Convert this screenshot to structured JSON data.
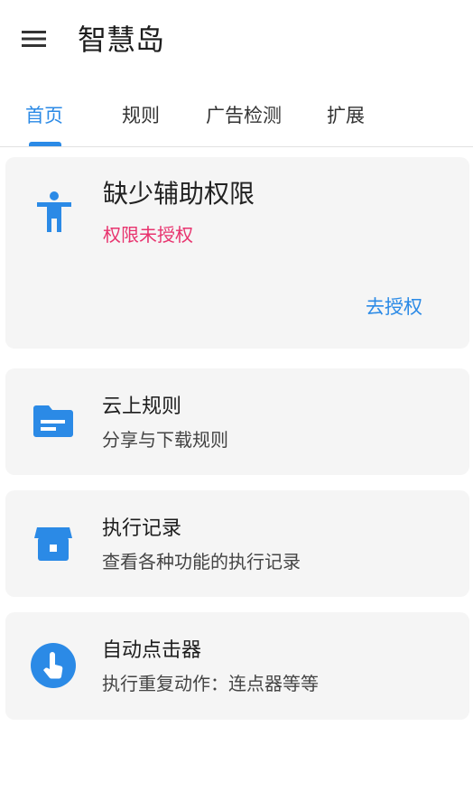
{
  "app": {
    "title": "智慧岛"
  },
  "tabs": [
    {
      "label": "首页",
      "active": true
    },
    {
      "label": "规则",
      "active": false
    },
    {
      "label": "广告检测",
      "active": false
    },
    {
      "label": "扩展",
      "active": false
    }
  ],
  "permission_card": {
    "icon": "accessibility-icon",
    "title": "缺少辅助权限",
    "subtitle": "权限未授权",
    "action_label": "去授权"
  },
  "cards": [
    {
      "icon": "folder-icon",
      "title": "云上规则",
      "subtitle": "分享与下载规则"
    },
    {
      "icon": "archive-icon",
      "title": "执行记录",
      "subtitle": "查看各种功能的执行记录"
    },
    {
      "icon": "touch-icon",
      "title": "自动点击器",
      "subtitle": "执行重复动作：连点器等等"
    }
  ],
  "colors": {
    "accent": "#2b8ae6",
    "warning": "#e8336e",
    "card_background": "#f5f5f5"
  }
}
